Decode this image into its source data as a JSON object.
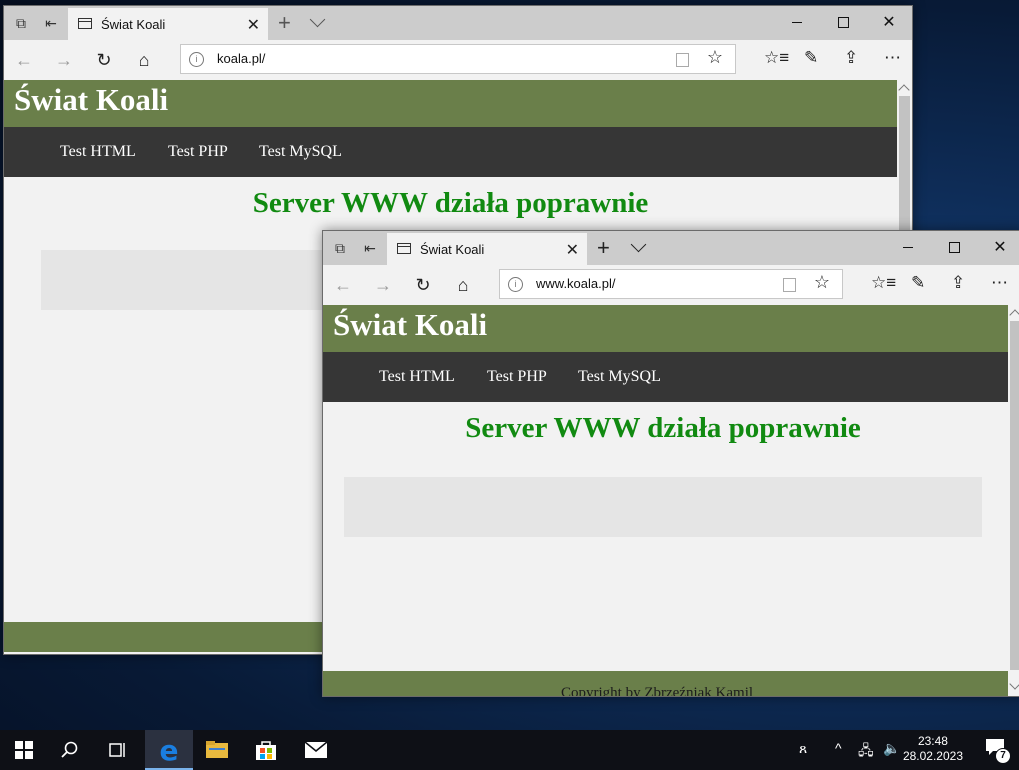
{
  "back_window": {
    "tab_title": "Świat Koali",
    "url": "koala.pl/",
    "site_title": "Świat Koali",
    "nav": [
      "Test HTML",
      "Test PHP",
      "Test MySQL"
    ],
    "heading": "Server WWW działa poprawnie"
  },
  "front_window": {
    "tab_title": "Świat Koali",
    "url": "www.koala.pl/",
    "site_title": "Świat Koali",
    "nav": [
      "Test HTML",
      "Test PHP",
      "Test MySQL"
    ],
    "heading": "Server WWW działa poprawnie",
    "footer": "Copyright by Zbrzeźniak Kamil"
  },
  "window_controls": {
    "minimize": "—",
    "close": "✕"
  },
  "taskbar": {
    "time": "23:48",
    "date": "28.02.2023",
    "notification_count": "7"
  },
  "colors": {
    "header_green": "#6a7f4a",
    "nav_dark": "#363636",
    "heading_green": "#118a11"
  }
}
